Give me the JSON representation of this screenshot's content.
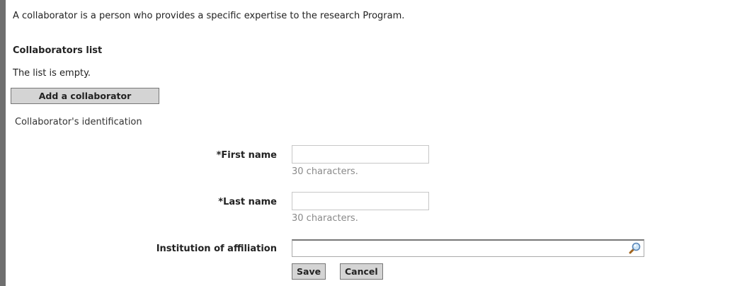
{
  "intro_text": "A collaborator is a person who provides a specific expertise to the research Program.",
  "collaborators_list": {
    "heading": "Collaborators list",
    "empty_message": "The list is empty.",
    "add_button_label": "Add a collaborator"
  },
  "form": {
    "heading": "Collaborator's identification",
    "first_name": {
      "label": "*First name",
      "value": "",
      "hint": "30 characters."
    },
    "last_name": {
      "label": "*Last name",
      "value": "",
      "hint": "30 characters."
    },
    "institution": {
      "label": "Institution of affiliation",
      "value": "",
      "icon": "magnifier-search-icon"
    },
    "save_label": "Save",
    "cancel_label": "Cancel"
  },
  "colors": {
    "button_bg": "#d4d4d4",
    "side_bar": "#6f6f6f",
    "hint_text": "#8a8a8a"
  }
}
